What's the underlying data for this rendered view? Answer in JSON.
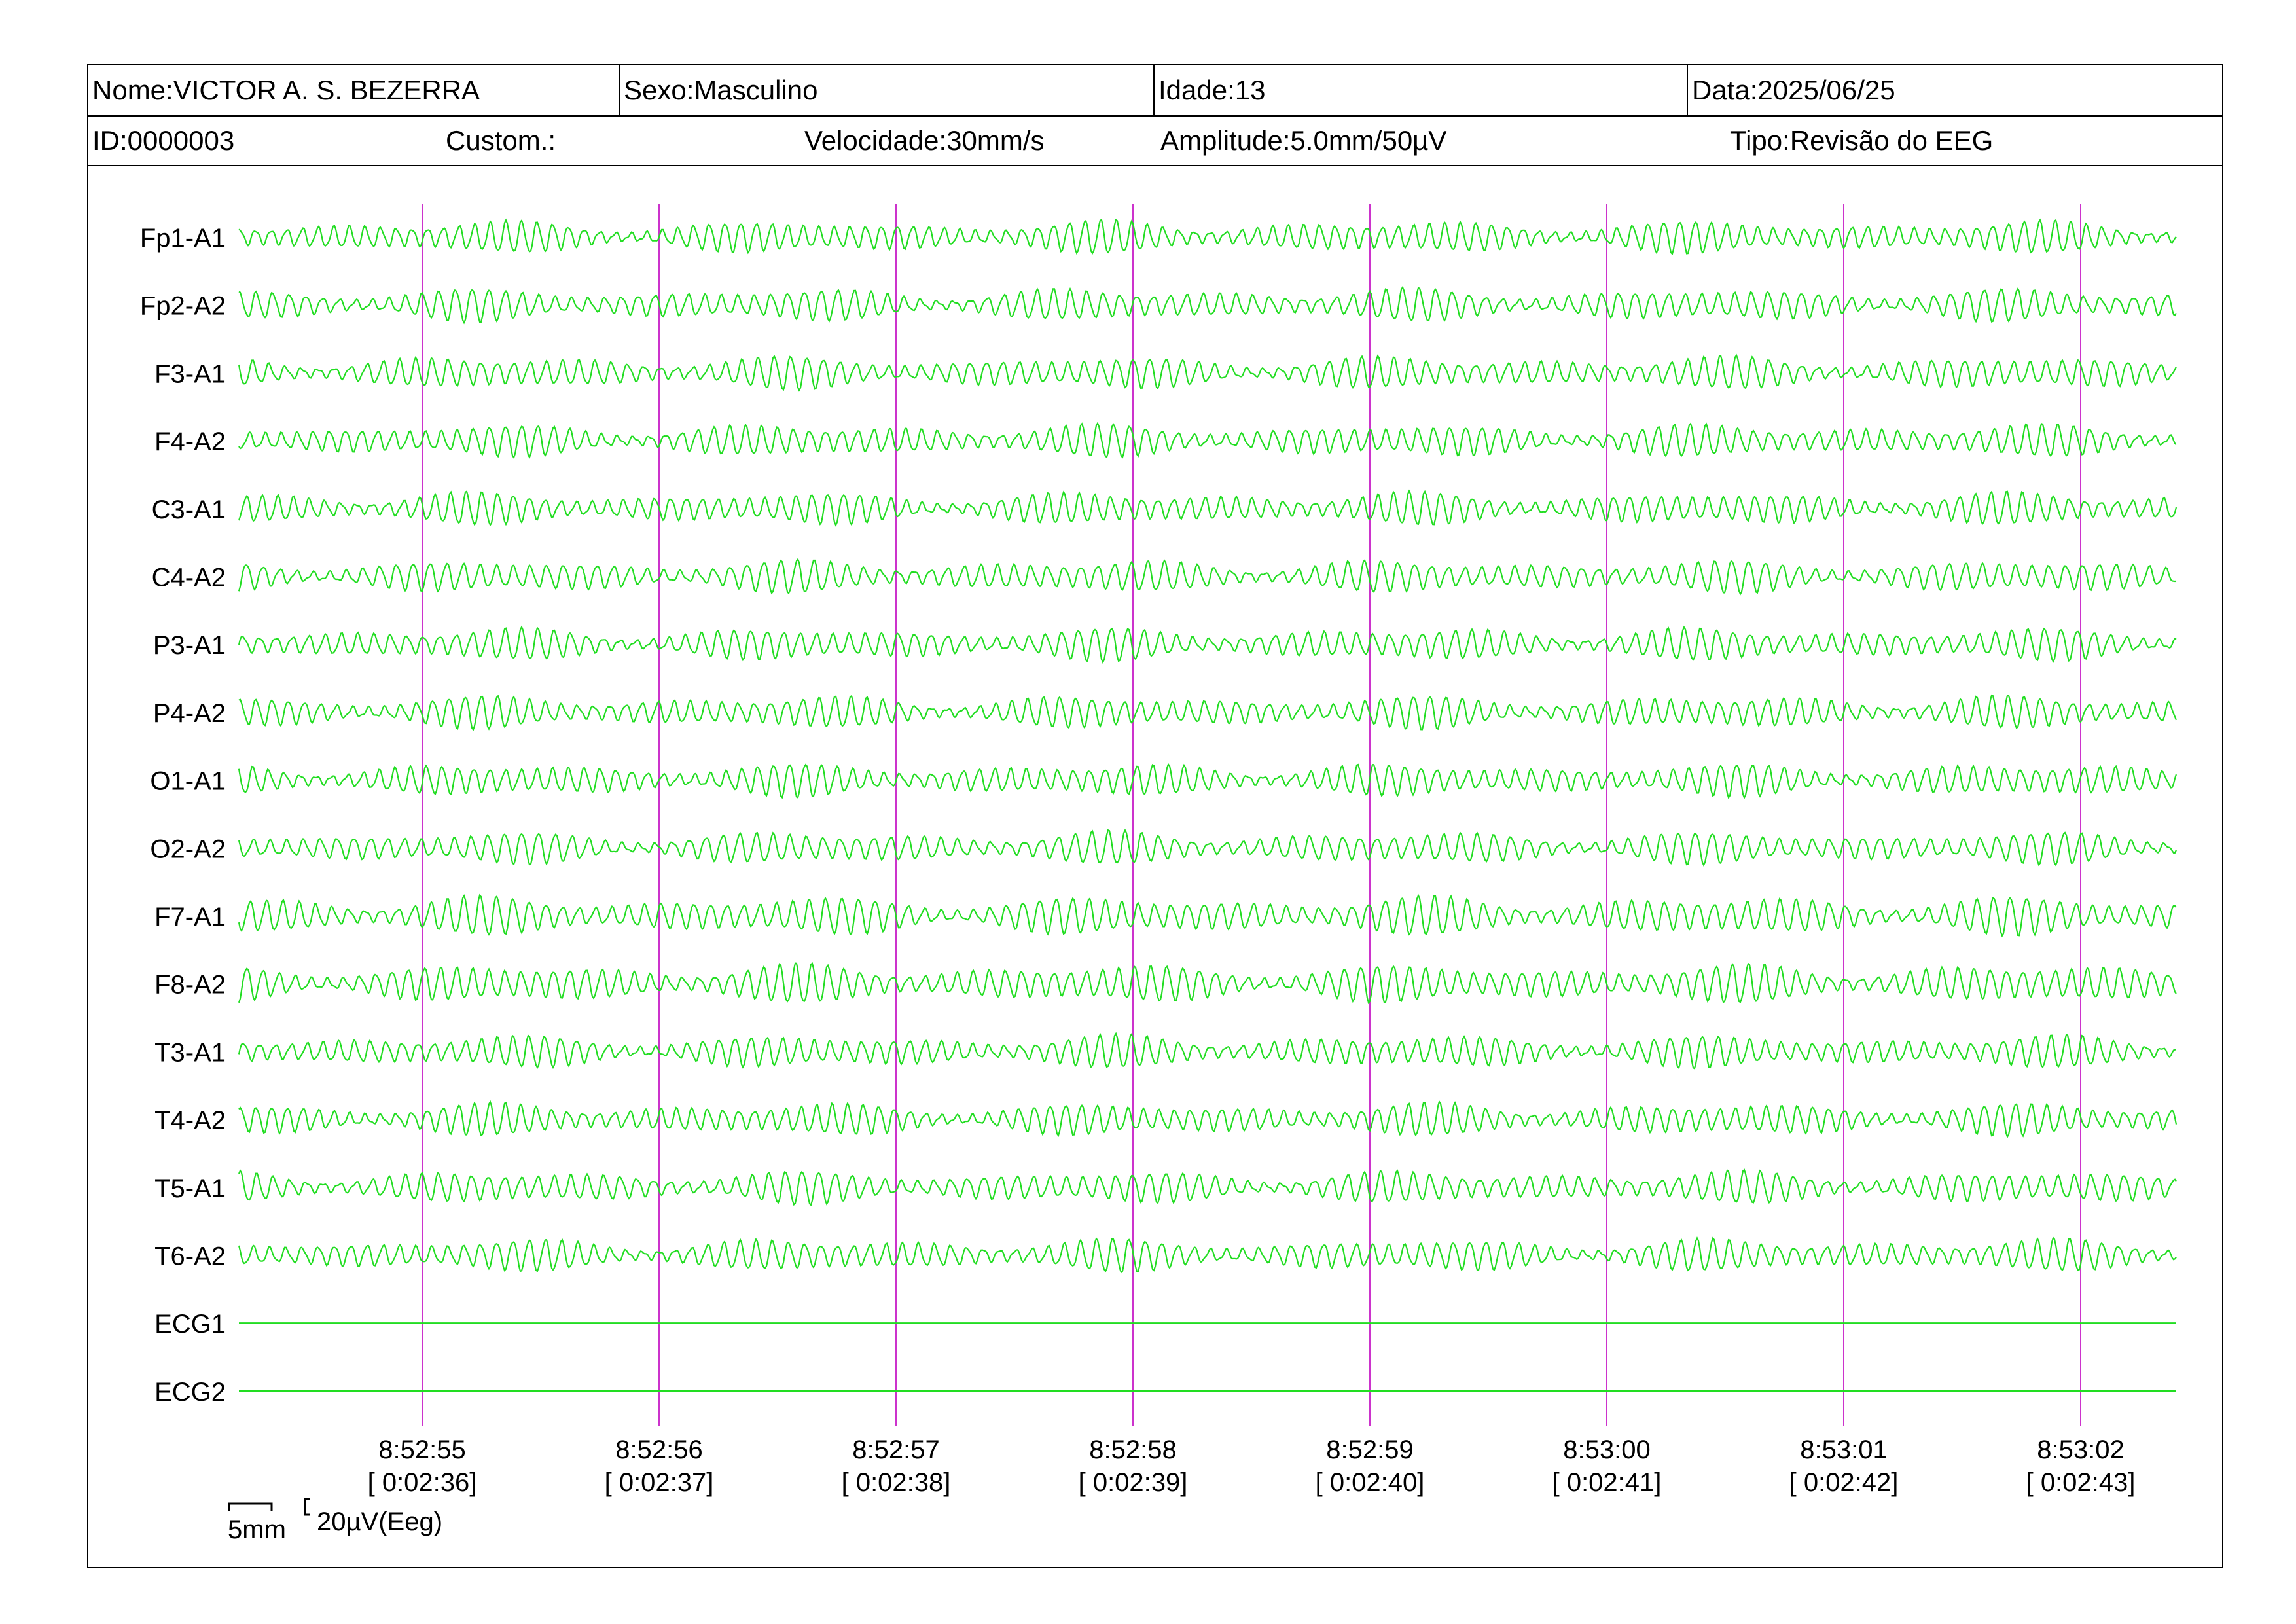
{
  "header": {
    "nome": "Nome:VICTOR A. S. BEZERRA",
    "sexo": "Sexo:Masculino",
    "idade": "Idade:13",
    "data": "Data:2025/06/25",
    "id": "ID:0000003",
    "custom": "Custom.:",
    "velocidade": "Velocidade:30mm/s",
    "amplitude": "Amplitude:5.0mm/50µV",
    "tipo": "Tipo:Revisão do EEG"
  },
  "chart_data": {
    "type": "line",
    "title": "",
    "xlabel": "",
    "ylabel": "",
    "grid": false,
    "colors": {
      "trace": "#22dd22",
      "marker": "#cc33cc",
      "text": "#000000",
      "border": "#000000"
    },
    "time_ticks": [
      {
        "clock": "8:52:55",
        "elapsed": "[ 0:02:36]"
      },
      {
        "clock": "8:52:56",
        "elapsed": "[ 0:02:37]"
      },
      {
        "clock": "8:52:57",
        "elapsed": "[ 0:02:38]"
      },
      {
        "clock": "8:52:58",
        "elapsed": "[ 0:02:39]"
      },
      {
        "clock": "8:52:59",
        "elapsed": "[ 0:02:40]"
      },
      {
        "clock": "8:53:00",
        "elapsed": "[ 0:02:41]"
      },
      {
        "clock": "8:53:01",
        "elapsed": "[ 0:02:42]"
      },
      {
        "clock": "8:53:02",
        "elapsed": "[ 0:02:43]"
      }
    ],
    "channels": [
      {
        "name": "Fp1-A1",
        "kind": "eeg"
      },
      {
        "name": "Fp2-A2",
        "kind": "eeg"
      },
      {
        "name": "F3-A1",
        "kind": "eeg"
      },
      {
        "name": "F4-A2",
        "kind": "eeg"
      },
      {
        "name": "C3-A1",
        "kind": "eeg"
      },
      {
        "name": "C4-A2",
        "kind": "eeg"
      },
      {
        "name": "P3-A1",
        "kind": "eeg"
      },
      {
        "name": "P4-A2",
        "kind": "eeg"
      },
      {
        "name": "O1-A1",
        "kind": "eeg"
      },
      {
        "name": "O2-A2",
        "kind": "eeg"
      },
      {
        "name": "F7-A1",
        "kind": "eeg"
      },
      {
        "name": "F8-A2",
        "kind": "eeg"
      },
      {
        "name": "T3-A1",
        "kind": "eeg"
      },
      {
        "name": "T4-A2",
        "kind": "eeg"
      },
      {
        "name": "T5-A1",
        "kind": "eeg"
      },
      {
        "name": "T6-A2",
        "kind": "eeg"
      },
      {
        "name": "ECG1",
        "kind": "flat"
      },
      {
        "name": "ECG2",
        "kind": "flat"
      }
    ],
    "scale": {
      "time_label": "5mm",
      "amp_label": "20µV(Eeg)"
    }
  }
}
